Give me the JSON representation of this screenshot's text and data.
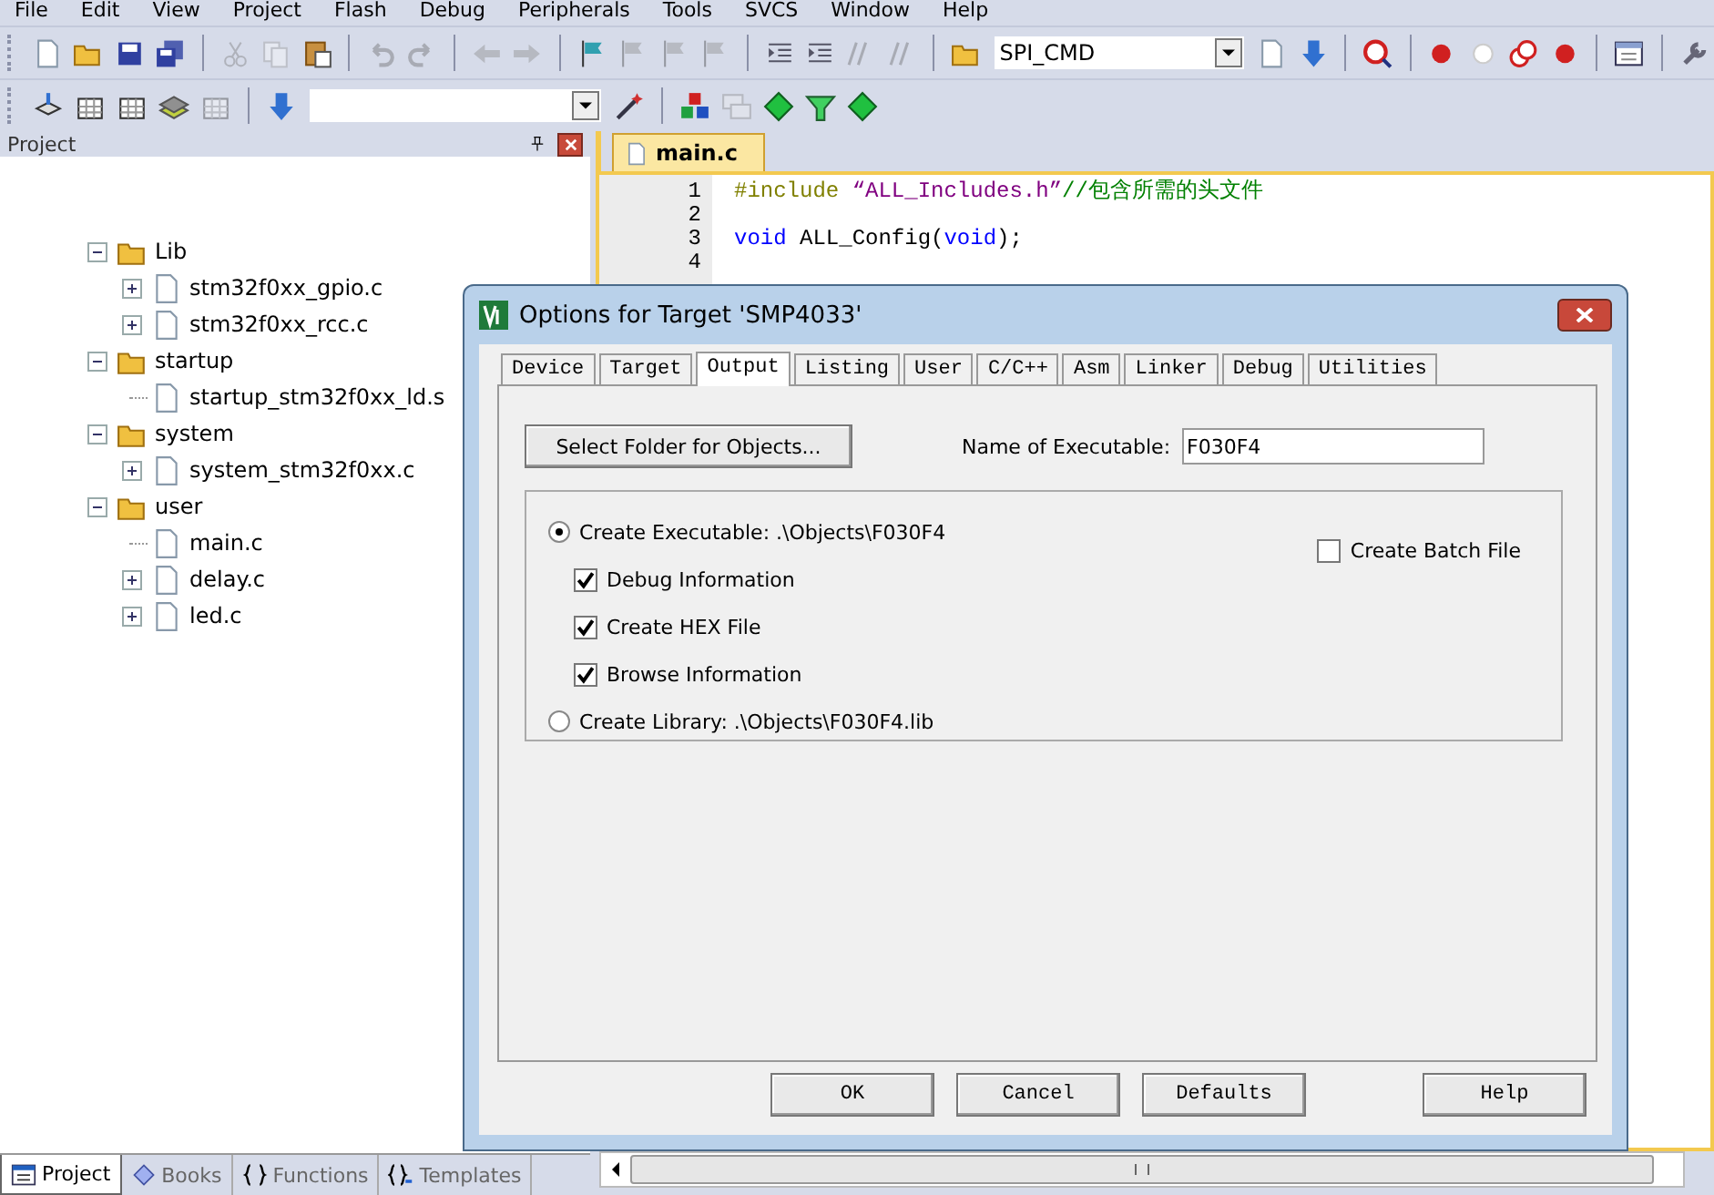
{
  "menu_bar": [
    "File",
    "Edit",
    "View",
    "Project",
    "Flash",
    "Debug",
    "Peripherals",
    "Tools",
    "SVCS",
    "Window",
    "Help"
  ],
  "toolbar_1": [
    {
      "kind": "document",
      "disabled": false
    },
    {
      "kind": "folder",
      "disabled": false
    },
    {
      "kind": "floppy-disk",
      "disabled": false
    },
    {
      "kind": "floppy-disks",
      "disabled": false
    },
    {
      "kind": "separator"
    },
    {
      "kind": "scissors",
      "disabled": true
    },
    {
      "kind": "pages",
      "disabled": true
    },
    {
      "kind": "clipboard",
      "disabled": false
    },
    {
      "kind": "separator"
    },
    {
      "kind": "undo",
      "disabled": true
    },
    {
      "kind": "redo",
      "disabled": true
    },
    {
      "kind": "separator"
    },
    {
      "kind": "back-arrow",
      "disabled": true
    },
    {
      "kind": "forward-arrow",
      "disabled": true
    },
    {
      "kind": "separator"
    },
    {
      "kind": "flag",
      "disabled": false
    },
    {
      "kind": "flag",
      "disabled": true
    },
    {
      "kind": "flag",
      "disabled": true
    },
    {
      "kind": "flag",
      "disabled": true
    },
    {
      "kind": "separator"
    },
    {
      "kind": "indent",
      "disabled": false
    },
    {
      "kind": "indent",
      "disabled": false
    },
    {
      "kind": "slashes",
      "disabled": true
    },
    {
      "kind": "slashes",
      "disabled": true
    },
    {
      "kind": "separator"
    },
    {
      "kind": "folder",
      "disabled": false
    },
    {
      "kind": "combo",
      "value": "SPI_CMD"
    },
    {
      "kind": "document",
      "disabled": false
    },
    {
      "kind": "down-arrow",
      "disabled": false
    },
    {
      "kind": "separator"
    },
    {
      "kind": "magnifier",
      "disabled": false
    },
    {
      "kind": "separator"
    },
    {
      "kind": "red-dot",
      "disabled": false
    },
    {
      "kind": "hollow-circle",
      "disabled": false
    },
    {
      "kind": "double-circle",
      "disabled": false
    },
    {
      "kind": "red-dot",
      "disabled": false
    },
    {
      "kind": "separator"
    },
    {
      "kind": "window-dropdown",
      "disabled": false
    },
    {
      "kind": "separator"
    },
    {
      "kind": "wrench",
      "disabled": false
    }
  ],
  "toolbar_2": [
    {
      "kind": "stack-arrow",
      "disabled": false
    },
    {
      "kind": "grid",
      "disabled": false
    },
    {
      "kind": "grid",
      "disabled": false
    },
    {
      "kind": "layers",
      "disabled": false
    },
    {
      "kind": "grid",
      "disabled": true
    },
    {
      "kind": "separator"
    },
    {
      "kind": "down-arrow",
      "disabled": false
    },
    {
      "kind": "combo"
    },
    {
      "kind": "wand",
      "disabled": false
    },
    {
      "kind": "separator"
    },
    {
      "kind": "blocks",
      "disabled": false
    },
    {
      "kind": "windows",
      "disabled": true
    },
    {
      "kind": "green-diamond",
      "disabled": false
    },
    {
      "kind": "funnel",
      "disabled": false
    },
    {
      "kind": "green-diamond",
      "disabled": false
    }
  ],
  "project_panel": {
    "title": "Project",
    "tree": [
      {
        "label": "Lib",
        "kind": "folder",
        "expanded": true,
        "children": [
          {
            "label": "stm32f0xx_gpio.c",
            "kind": "file",
            "expanded": false
          },
          {
            "label": "stm32f0xx_rcc.c",
            "kind": "file",
            "expanded": false
          }
        ]
      },
      {
        "label": "startup",
        "kind": "folder",
        "expanded": true,
        "children": [
          {
            "label": "startup_stm32f0xx_ld.s",
            "kind": "file"
          }
        ]
      },
      {
        "label": "system",
        "kind": "folder",
        "expanded": true,
        "children": [
          {
            "label": "system_stm32f0xx.c",
            "kind": "file",
            "expanded": false
          }
        ]
      },
      {
        "label": "user",
        "kind": "folder",
        "expanded": true,
        "children": [
          {
            "label": "main.c",
            "kind": "file"
          },
          {
            "label": "delay.c",
            "kind": "file",
            "expanded": false
          },
          {
            "label": "led.c",
            "kind": "file",
            "expanded": false
          }
        ]
      }
    ],
    "tabs": [
      {
        "label": "Project",
        "kind": "project",
        "selected": true
      },
      {
        "label": "Books",
        "kind": "books",
        "selected": false
      },
      {
        "label": "Functions",
        "kind": "functions",
        "selected": false
      },
      {
        "label": "Templates",
        "kind": "templates",
        "selected": false
      }
    ]
  },
  "editor": {
    "tabs": [
      {
        "label": "main.c",
        "selected": true
      }
    ],
    "lines": [
      {
        "number": "1",
        "tokens": [
          {
            "kind": "preprocessor",
            "text": "#include "
          },
          {
            "kind": "string",
            "text": "“ALL_Includes.h”"
          },
          {
            "kind": "comment",
            "text": "//包含所需的头文件"
          }
        ]
      },
      {
        "number": "2"
      },
      {
        "number": "3",
        "tokens": [
          {
            "kind": "keyword",
            "text": "void"
          },
          {
            "kind": "plain",
            "text": " ALL_Config("
          },
          {
            "kind": "keyword",
            "text": "void"
          },
          {
            "kind": "plain",
            "text": ");"
          }
        ]
      },
      {
        "number": "4"
      }
    ]
  },
  "dialog": {
    "title": "Options for Target 'SMP4033'",
    "tabs": [
      {
        "label": "Device",
        "selected": false
      },
      {
        "label": "Target",
        "selected": false
      },
      {
        "label": "Output",
        "selected": true
      },
      {
        "label": "Listing",
        "selected": false
      },
      {
        "label": "User",
        "selected": false
      },
      {
        "label": "C/C++",
        "selected": false
      },
      {
        "label": "Asm",
        "selected": false
      },
      {
        "label": "Linker",
        "selected": false
      },
      {
        "label": "Debug",
        "selected": false
      },
      {
        "label": "Utilities",
        "selected": false
      }
    ],
    "select_folder_button": "Select Folder for Objects...",
    "executable_name": {
      "label": "Name of Executable:",
      "value": "F030F4"
    },
    "create_executable": {
      "label": "Create Executable:  .\\Objects\\F030F4",
      "selected": true
    },
    "options": [
      {
        "label": "Debug Information",
        "checked": true
      },
      {
        "label": "Create HEX File",
        "checked": true
      },
      {
        "label": "Browse Information",
        "checked": true
      }
    ],
    "create_batch_file": {
      "label": "Create Batch File",
      "checked": false
    },
    "create_library": {
      "label": "Create Library:  .\\Objects\\F030F4.lib",
      "selected": false
    },
    "buttons": [
      "OK",
      "Cancel",
      "Defaults",
      "Help"
    ]
  }
}
